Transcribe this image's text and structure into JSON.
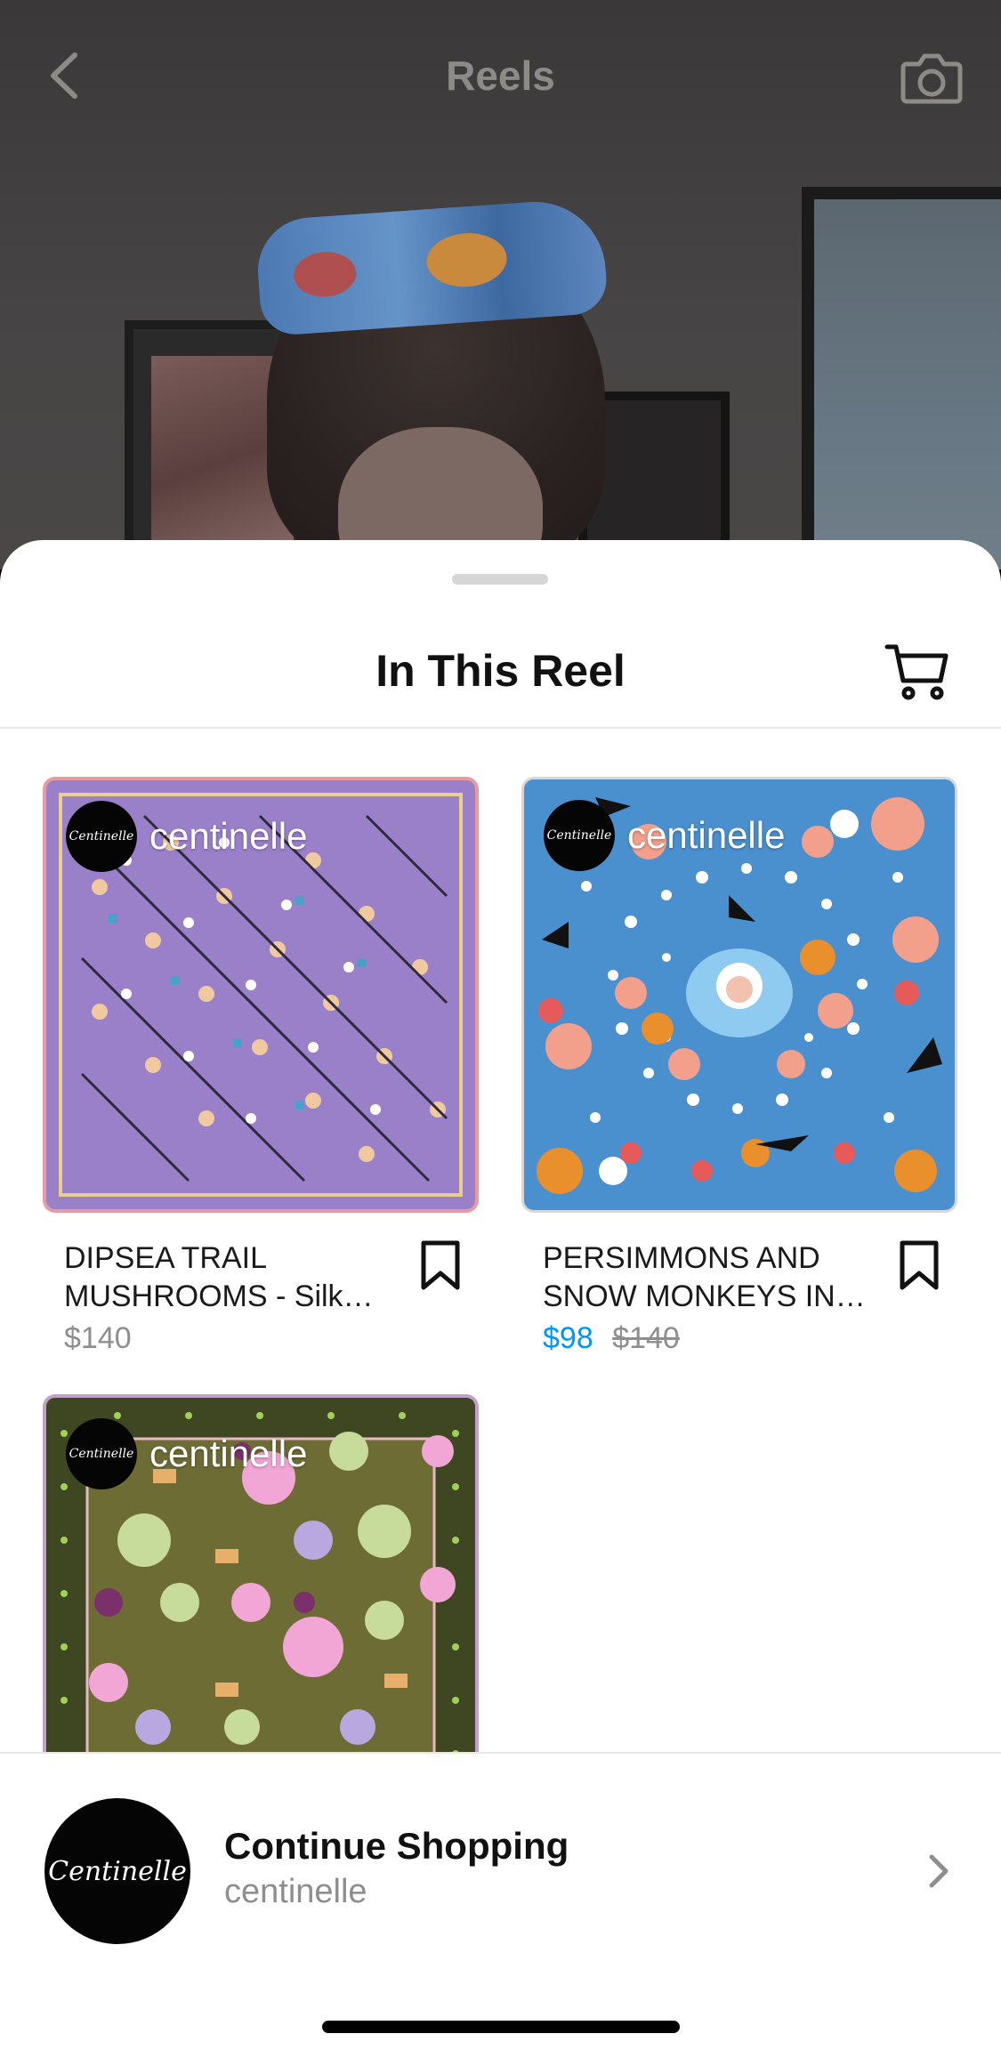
{
  "top_bar": {
    "title": "Reels",
    "back_icon": "chevron-left-icon",
    "camera_icon": "camera-icon"
  },
  "sheet": {
    "title": "In This Reel",
    "cart_icon": "shopping-cart-icon"
  },
  "brand": {
    "name": "centinelle",
    "avatar_text": "Centinelle"
  },
  "products": [
    {
      "title": "DIPSEA TRAIL\nMUSHROOMS  - Silk…",
      "price": "$140",
      "sale_price": "",
      "original_price": ""
    },
    {
      "title": "PERSIMMONS AND\nSNOW MONKEYS IN…",
      "price": "",
      "sale_price": "$98",
      "original_price": "$140"
    },
    {
      "title": "",
      "price": "",
      "sale_price": "",
      "original_price": ""
    }
  ],
  "continue_shopping": {
    "title": "Continue Shopping",
    "subtitle": "centinelle",
    "avatar_text": "Centinelle"
  },
  "colors": {
    "sale": "#0095f6",
    "muted": "#8e8e8e",
    "text": "#111111"
  }
}
